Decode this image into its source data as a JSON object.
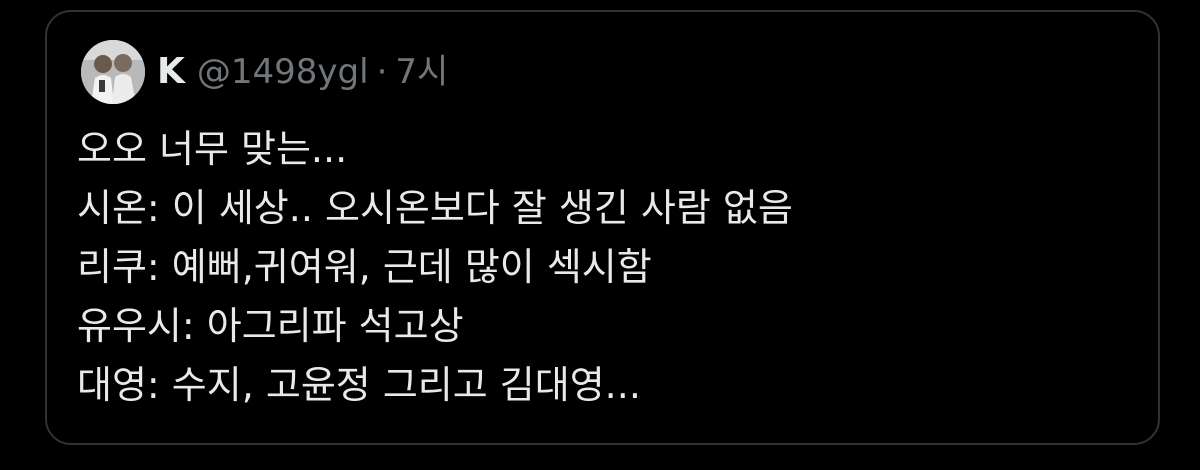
{
  "tweet": {
    "author": {
      "display_name": "K",
      "handle": "@1498ygl",
      "separator": "·",
      "timestamp": "7시"
    },
    "lines": [
      "오오 너무 맞는...",
      "시온: 이 세상.. 오시온보다 잘 생긴 사람 없음",
      "리쿠: 예뻐,귀여워, 근데 많이 섹시함",
      "유우시: 아그리파 석고상",
      "대영: 수지, 고윤정 그리고 김대영..."
    ]
  },
  "colors": {
    "background": "#000000",
    "card_border": "#2f3336",
    "primary_text": "#e7e9ea",
    "secondary_text": "#71767b"
  }
}
